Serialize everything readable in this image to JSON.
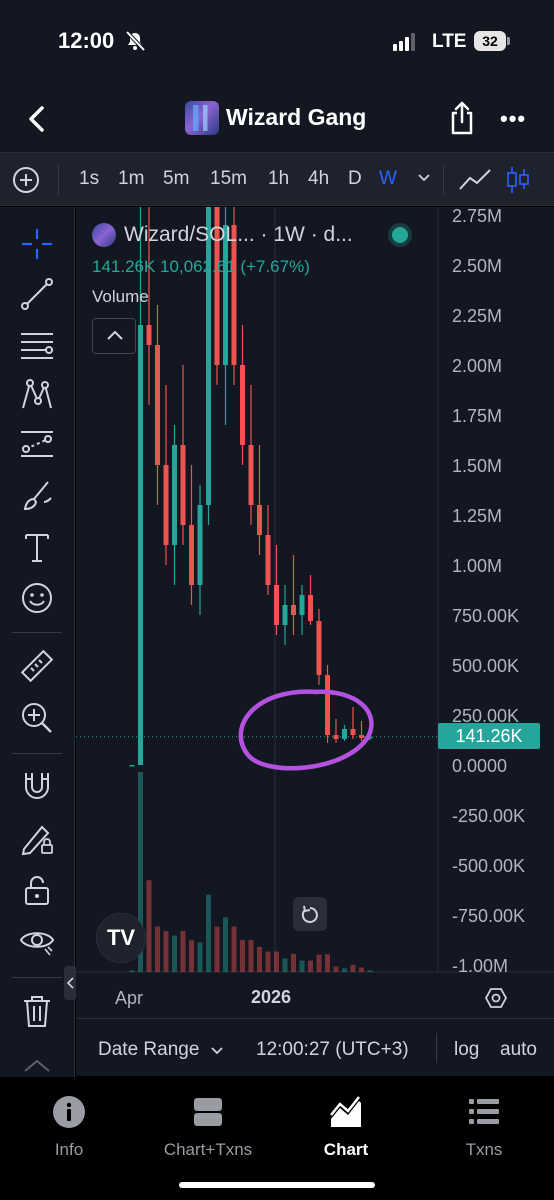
{
  "status_bar": {
    "time": "12:00",
    "network": "LTE",
    "battery": "32"
  },
  "header": {
    "title": "Wizard Gang"
  },
  "timeframes": {
    "items": [
      "1s",
      "1m",
      "5m",
      "15m",
      "1h",
      "4h",
      "D",
      "W"
    ],
    "selected": "W"
  },
  "legend": {
    "title": "Wizard/SOL... · 1W · d...",
    "values": "141.26K  10,062.61 (+7.67%)",
    "volume_label": "Volume"
  },
  "price_axis": {
    "ticks": [
      "2.75M",
      "2.50M",
      "2.25M",
      "2.00M",
      "1.75M",
      "1.50M",
      "1.25M",
      "1.00M",
      "750.00K",
      "500.00K",
      "250.00K",
      "0.0000",
      "-250.00K",
      "-500.00K",
      "-750.00K",
      "-1.00M"
    ],
    "current_price_label": "141.26K"
  },
  "time_axis": {
    "labels": [
      "Apr",
      "2026"
    ]
  },
  "logo_text": "TV",
  "bottom_strip": {
    "date_range": "Date Range",
    "clock": "12:00:27 (UTC+3)",
    "log": "log",
    "auto": "auto"
  },
  "nav": [
    {
      "label": "Info",
      "icon": "info-icon",
      "active": false
    },
    {
      "label": "Chart+Txns",
      "icon": "split-view-icon",
      "active": false
    },
    {
      "label": "Chart",
      "icon": "chart-icon",
      "active": true
    },
    {
      "label": "Txns",
      "icon": "list-icon",
      "active": false
    }
  ],
  "colors": {
    "up": "#26a69a",
    "down": "#ef5350",
    "accent": "#2962ff",
    "annotation": "#b452e0"
  },
  "chart_data": {
    "type": "candlestick",
    "interval": "1W",
    "ylim": [
      -1000000,
      2750000
    ],
    "y_ticks": [
      2750000,
      2500000,
      2250000,
      2000000,
      1750000,
      1500000,
      1250000,
      1000000,
      750000,
      500000,
      250000,
      0,
      -250000,
      -500000,
      -750000,
      -1000000
    ],
    "last_price": 141260,
    "candles": [
      {
        "o": 0,
        "h": 5,
        "l": 0,
        "c": 5
      },
      {
        "o": 5,
        "h": 2900000,
        "l": 0,
        "c": 2200000
      },
      {
        "o": 2200000,
        "h": 2900000,
        "l": 1800000,
        "c": 2100000
      },
      {
        "o": 2100000,
        "h": 2300000,
        "l": 1300000,
        "c": 1500000
      },
      {
        "o": 1500000,
        "h": 1900000,
        "l": 1000000,
        "c": 1100000
      },
      {
        "o": 1100000,
        "h": 1700000,
        "l": 900000,
        "c": 1600000
      },
      {
        "o": 1600000,
        "h": 2000000,
        "l": 1100000,
        "c": 1200000
      },
      {
        "o": 1200000,
        "h": 1500000,
        "l": 800000,
        "c": 900000
      },
      {
        "o": 900000,
        "h": 1400000,
        "l": 750000,
        "c": 1300000
      },
      {
        "o": 1300000,
        "h": 2900000,
        "l": 1200000,
        "c": 2800000
      },
      {
        "o": 2800000,
        "h": 2900000,
        "l": 1900000,
        "c": 2000000
      },
      {
        "o": 2000000,
        "h": 2900000,
        "l": 1700000,
        "c": 2700000
      },
      {
        "o": 2700000,
        "h": 2900000,
        "l": 1900000,
        "c": 2000000
      },
      {
        "o": 2000000,
        "h": 2200000,
        "l": 1500000,
        "c": 1600000
      },
      {
        "o": 1600000,
        "h": 1900000,
        "l": 1200000,
        "c": 1300000
      },
      {
        "o": 1300000,
        "h": 1600000,
        "l": 1050000,
        "c": 1150000
      },
      {
        "o": 1150000,
        "h": 1300000,
        "l": 850000,
        "c": 900000
      },
      {
        "o": 900000,
        "h": 1100000,
        "l": 650000,
        "c": 700000
      },
      {
        "o": 700000,
        "h": 900000,
        "l": 600000,
        "c": 800000
      },
      {
        "o": 800000,
        "h": 1050000,
        "l": 650000,
        "c": 750000
      },
      {
        "o": 750000,
        "h": 900000,
        "l": 650000,
        "c": 850000
      },
      {
        "o": 850000,
        "h": 950000,
        "l": 700000,
        "c": 720000
      },
      {
        "o": 720000,
        "h": 780000,
        "l": 400000,
        "c": 450000
      },
      {
        "o": 450000,
        "h": 500000,
        "l": 110000,
        "c": 150000
      },
      {
        "o": 150000,
        "h": 230000,
        "l": 110000,
        "c": 130000
      },
      {
        "o": 130000,
        "h": 200000,
        "l": 120000,
        "c": 180000
      },
      {
        "o": 180000,
        "h": 290000,
        "l": 130000,
        "c": 150000
      },
      {
        "o": 150000,
        "h": 220000,
        "l": 120000,
        "c": 135000
      },
      {
        "o": 135000,
        "h": 160000,
        "l": 125000,
        "c": 141260
      }
    ]
  }
}
